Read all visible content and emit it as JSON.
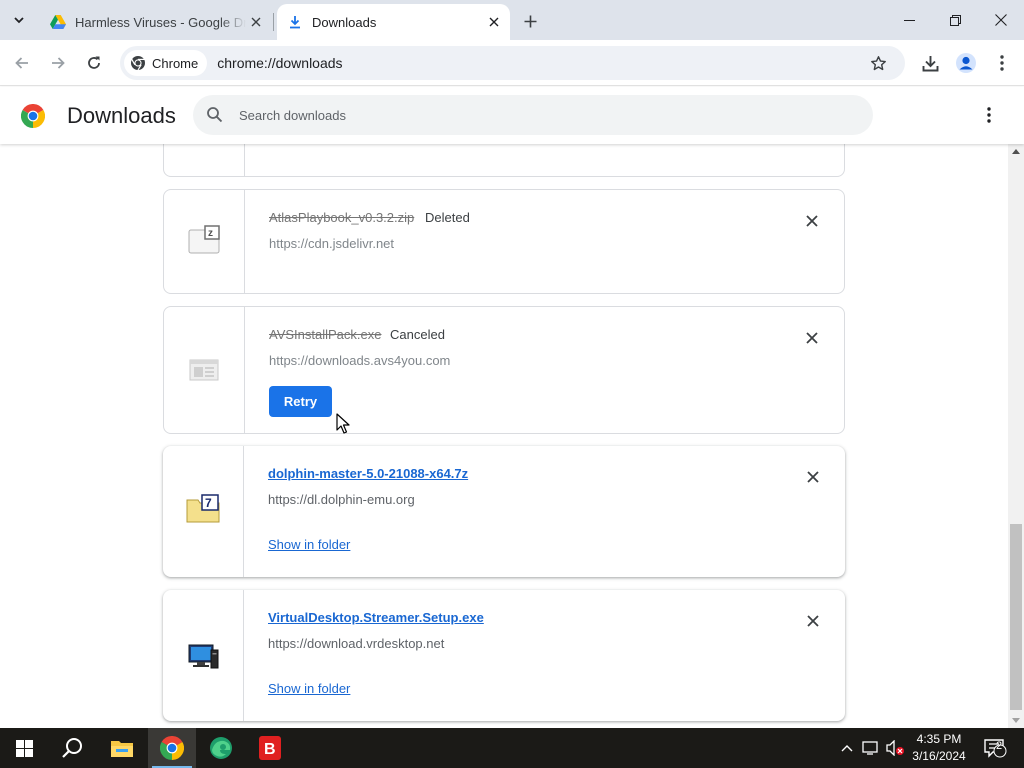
{
  "browser": {
    "tabs": [
      {
        "title": "Harmless Viruses - Google Drive",
        "active": false,
        "favicon": "google-drive-icon"
      },
      {
        "title": "Downloads",
        "active": true,
        "favicon": "download-icon"
      }
    ],
    "chip_label": "Chrome",
    "url": "chrome://downloads"
  },
  "header": {
    "title": "Downloads",
    "search_placeholder": "Search downloads"
  },
  "downloads": [
    {
      "filename": "AtlasPlaybook_v0.3.2.zip",
      "status": "Deleted",
      "source": "https://cdn.jsdelivr.net",
      "icon": "zip-file-icon"
    },
    {
      "filename": "AVSInstallPack.exe",
      "status": "Canceled",
      "source": "https://downloads.avs4you.com",
      "action": "Retry",
      "icon": "exe-file-icon"
    },
    {
      "filename": "dolphin-master-5.0-21088-x64.7z",
      "source": "https://dl.dolphin-emu.org",
      "action": "Show in folder",
      "icon": "7z-archive-icon"
    },
    {
      "filename": "VirtualDesktop.Streamer.Setup.exe",
      "source": "https://download.vrdesktop.net",
      "action": "Show in folder",
      "icon": "installer-icon"
    }
  ],
  "taskbar": {
    "time": "4:35 PM",
    "date": "3/16/2024",
    "notification_count": "2"
  },
  "colors": {
    "accent": "#1a73e8",
    "link": "#1967d2",
    "tabstrip": "#dee3eb"
  }
}
